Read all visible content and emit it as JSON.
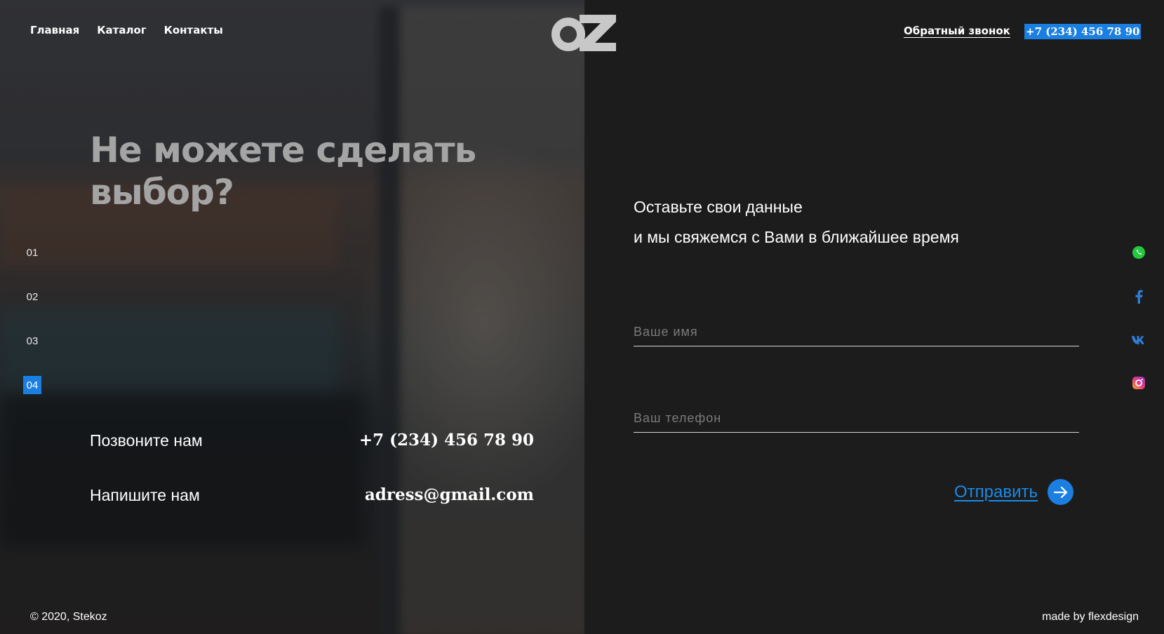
{
  "nav": {
    "items": [
      {
        "label": "Главная"
      },
      {
        "label": "Каталог"
      },
      {
        "label": "Контакты"
      }
    ]
  },
  "header": {
    "logo_text": "OZ",
    "callback_label": "Обратный звонок",
    "phone": "+7 (234) 456 78 90"
  },
  "hero": {
    "title": "Не можете сделать выбор?"
  },
  "slides": [
    "01",
    "02",
    "03",
    "04"
  ],
  "active_slide": "04",
  "contacts": {
    "call_label": "Позвоните нам",
    "call_value": "+7 (234) 456 78 90",
    "mail_label": "Напишите нам",
    "mail_value": "adress@gmail.com"
  },
  "form": {
    "intro_line1": "Оставьте свои данные",
    "intro_line2": "и мы свяжемся с Вами в ближайшее время",
    "name_placeholder": "Ваше имя",
    "phone_placeholder": "Ваш телефон",
    "submit_label": "Отправить"
  },
  "social": [
    "whatsapp-icon",
    "facebook-icon",
    "vk-icon",
    "instagram-icon"
  ],
  "footer": {
    "copyright": "© 2020, Stekoz",
    "made_by": "made by flexdesign"
  },
  "colors": {
    "accent": "#1a7fe0",
    "background": "#1c1c1c",
    "headline": "#a4a4a4"
  }
}
